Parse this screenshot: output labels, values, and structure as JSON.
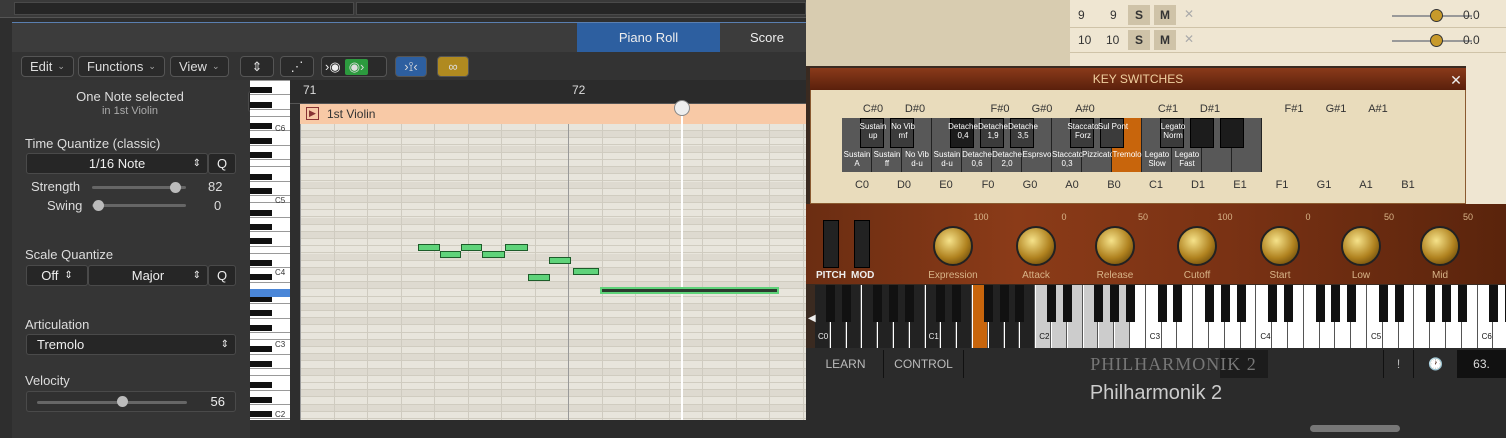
{
  "tabs": {
    "piano_roll": "Piano Roll",
    "score": "Score"
  },
  "toolbar": {
    "edit": "Edit",
    "functions": "Functions",
    "view": "View"
  },
  "inspector": {
    "selection_title": "One Note selected",
    "selection_sub": "in 1st Violin",
    "time_quantize_label": "Time Quantize (classic)",
    "time_quantize_value": "1/16 Note",
    "q": "Q",
    "strength_label": "Strength",
    "strength_value": "82",
    "swing_label": "Swing",
    "swing_value": "0",
    "scale_quantize_label": "Scale Quantize",
    "scale_off": "Off",
    "scale_major": "Major",
    "articulation_label": "Articulation",
    "articulation_value": "Tremolo",
    "velocity_label": "Velocity",
    "velocity_value": "56"
  },
  "ruler": {
    "bar1": "71",
    "bar2": "72"
  },
  "region": {
    "name": "1st Violin"
  },
  "octaves": {
    "c6": "C6",
    "c5": "C5",
    "c4": "C4",
    "c3": "C3",
    "c2": "C2"
  },
  "mixer": {
    "rows": [
      {
        "num": "9",
        "ch": "9",
        "s": "S",
        "m": "M",
        "x": "✕",
        "val": "0.0"
      },
      {
        "num": "10",
        "ch": "10",
        "s": "S",
        "m": "M",
        "x": "✕",
        "val": "0.0"
      }
    ]
  },
  "keyswitch": {
    "title": "KEY SWITCHES",
    "close": "✕",
    "top_notes": [
      "C#0",
      "D#0",
      "F#0",
      "G#0",
      "A#0",
      "C#1",
      "D#1",
      "F#1",
      "G#1",
      "A#1"
    ],
    "bottom_notes": [
      "C0",
      "D0",
      "E0",
      "F0",
      "G0",
      "A0",
      "B0",
      "C1",
      "D1",
      "E1",
      "F1",
      "G1",
      "A1",
      "B1"
    ],
    "black_labels": [
      "Sustain up",
      "No Vib mf",
      "",
      "Detache 0,4",
      "Detache 1,9",
      "Detache 3,5",
      "Staccato Forz",
      "Sul Pont",
      "Legato Norm",
      "",
      ""
    ],
    "white_labels": [
      "Sustain A",
      "Sustain ff",
      "No Vib d-u",
      "Sustain d-u",
      "Detache 0,6",
      "Detache 2,0",
      "Esprsvo",
      "Staccato 0,3",
      "Pizzicato",
      "Tremolo",
      "Legato Slow",
      "Legato Fast",
      "",
      ""
    ]
  },
  "controls": {
    "pitch": "PITCH",
    "mod": "MOD",
    "knobs": [
      {
        "label": "Expression",
        "val": "100"
      },
      {
        "label": "Attack",
        "val": "0"
      },
      {
        "label": "Release",
        "val": "50"
      },
      {
        "label": "Cutoff",
        "val": "100"
      },
      {
        "label": "Start",
        "val": "0"
      },
      {
        "label": "Low",
        "val": "50"
      },
      {
        "label": "Mid",
        "val": "50"
      }
    ]
  },
  "keyboard": {
    "c0": "C0",
    "c1": "C1",
    "c2": "C2",
    "c3": "C3",
    "c4": "C4",
    "c5": "C5",
    "c6": "C6"
  },
  "bottom": {
    "learn": "LEARN",
    "control": "CONTROL",
    "brand": "PHILHARMONIK 2",
    "brand2": "Philharmonik 2",
    "excl": "!",
    "clock": "🕐",
    "value": "63."
  }
}
